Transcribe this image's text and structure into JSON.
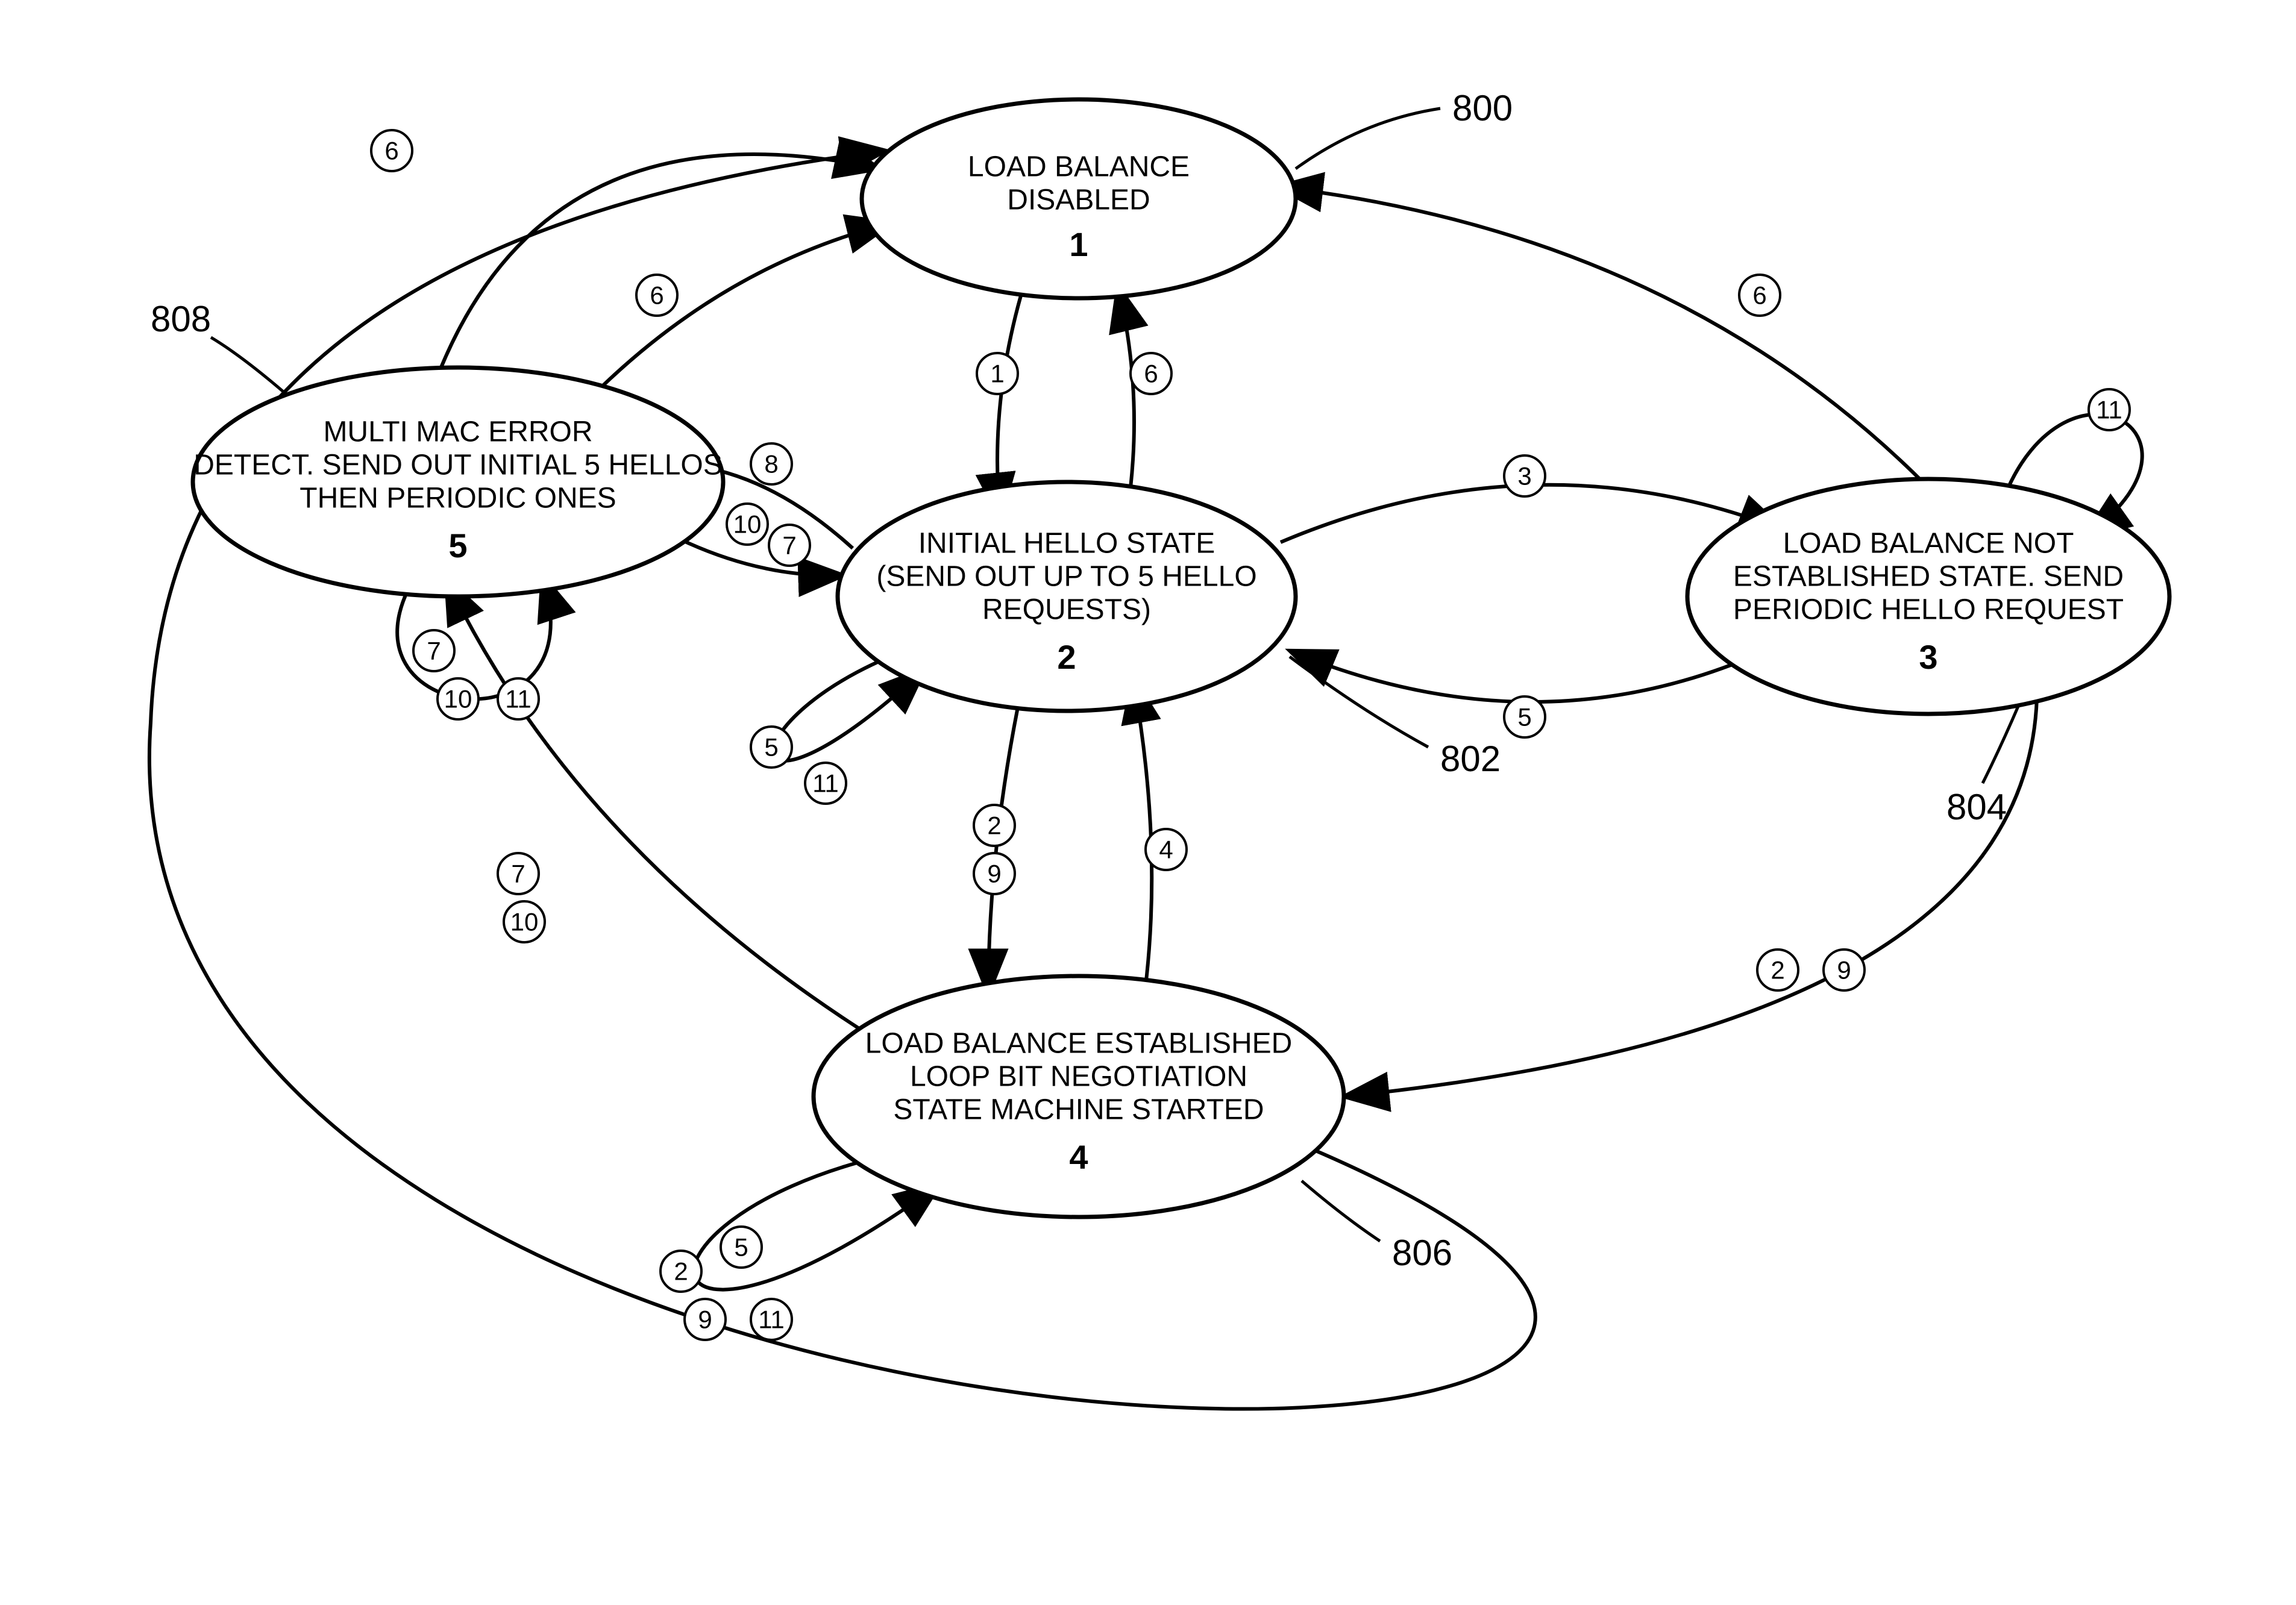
{
  "states": {
    "s1": {
      "num": "1",
      "l1": "LOAD BALANCE",
      "l2": "DISABLED"
    },
    "s2": {
      "num": "2",
      "l1": "INITIAL HELLO STATE",
      "l2": "(SEND OUT UP TO 5 HELLO",
      "l3": "REQUESTS)"
    },
    "s3": {
      "num": "3",
      "l1": "LOAD BALANCE NOT",
      "l2": "ESTABLISHED STATE. SEND",
      "l3": "PERIODIC HELLO REQUEST"
    },
    "s4": {
      "num": "4",
      "l1": "LOAD BALANCE ESTABLISHED",
      "l2": "LOOP BIT NEGOTIATION",
      "l3": "STATE MACHINE STARTED"
    },
    "s5": {
      "num": "5",
      "l1": "MULTI MAC ERROR",
      "l2": "DETECT. SEND OUT INITIAL 5 HELLOS",
      "l3": "THEN PERIODIC ONES"
    }
  },
  "callouts": {
    "c800": "800",
    "c802": "802",
    "c804": "804",
    "c806": "806",
    "c808": "808"
  },
  "events": {
    "e1": "1",
    "e2": "2",
    "e3": "3",
    "e4": "4",
    "e5": "5",
    "e6": "6",
    "e7": "7",
    "e8": "8",
    "e9": "9",
    "e10": "10",
    "e11": "11"
  }
}
